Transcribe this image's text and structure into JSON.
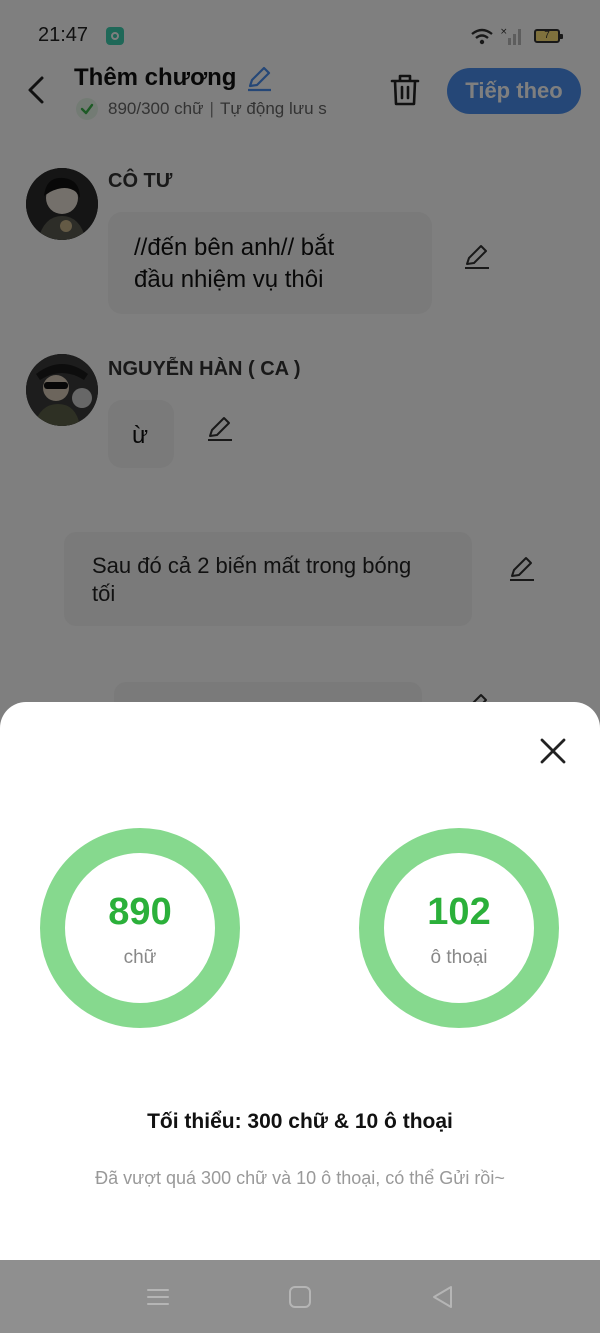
{
  "status_bar": {
    "time": "21:47",
    "battery": "7"
  },
  "header": {
    "title": "Thêm chương",
    "word_count": "890/300 chữ",
    "separator": "|",
    "autosave": "Tự động lưu s",
    "next_label": "Tiếp theo"
  },
  "messages": [
    {
      "name": "CÔ TƯ",
      "text_line1": "//đến bên anh// bắt",
      "text_line2": "đầu nhiệm vụ thôi"
    },
    {
      "name": "NGUYỄN HÀN ( CA )",
      "text": "ừ"
    }
  ],
  "narration": {
    "line1": "Sau đó cả 2 biến mất trong bóng",
    "line2": "tối"
  },
  "sheet": {
    "words_value": "890",
    "words_unit": "chữ",
    "dialogs_value": "102",
    "dialogs_unit": "ô thoại",
    "minimum": "Tối thiểu: 300 chữ & 10 ô thoại",
    "hint": "Đã vượt quá 300 chữ và 10 ô thoại, có thể Gửi rồi~"
  },
  "colors": {
    "accent": "#4a8fee",
    "ring": "#86d98e",
    "ring_text": "#2bb03a"
  },
  "icons": [
    "back-arrow-icon",
    "pencil-icon",
    "trash-icon",
    "check-icon",
    "close-icon",
    "menu-icon",
    "home-square-icon",
    "back-triangle-icon"
  ]
}
